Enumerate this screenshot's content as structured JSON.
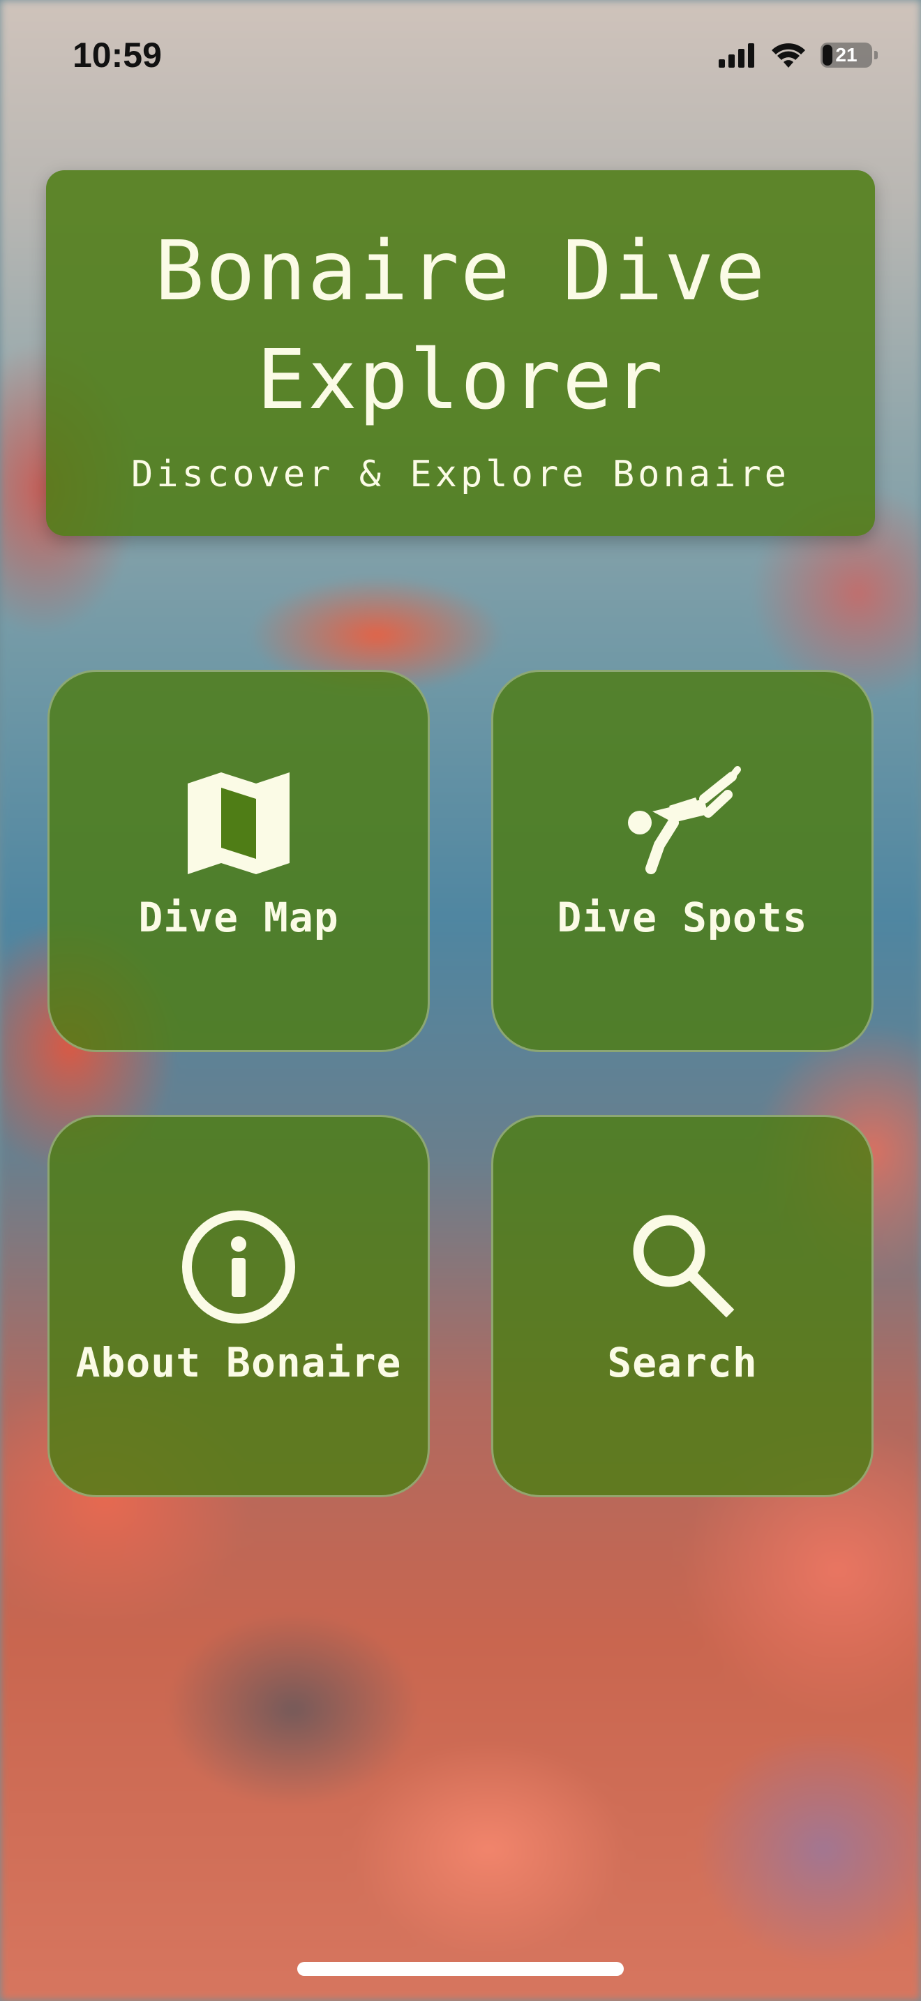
{
  "status_bar": {
    "time": "10:59",
    "battery_level": "21"
  },
  "header": {
    "title": "Bonaire Dive Explorer",
    "subtitle": "Discover & Explore Bonaire"
  },
  "tiles": [
    {
      "label": "Dive Map",
      "icon": "map-icon"
    },
    {
      "label": "Dive Spots",
      "icon": "diver-icon"
    },
    {
      "label": "About Bonaire",
      "icon": "info-icon"
    },
    {
      "label": "Search",
      "icon": "search-icon"
    }
  ],
  "colors": {
    "card_green": "#4f7d16",
    "text_cream": "#fbfbe6"
  }
}
